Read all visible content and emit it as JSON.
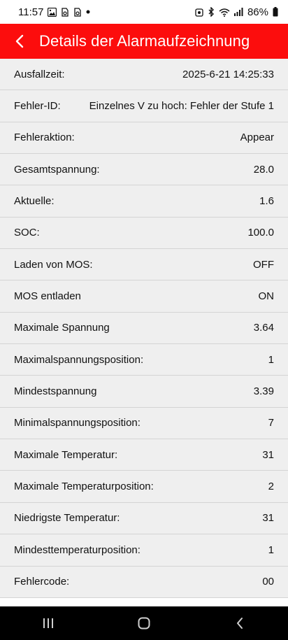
{
  "status_bar": {
    "time": "11:57",
    "battery": "86%",
    "icons": [
      "gallery-icon",
      "notification-icon",
      "notification-icon",
      "dot-icon",
      "alarm-icon",
      "bluetooth-icon",
      "wifi-icon",
      "signal-icon",
      "battery-icon"
    ]
  },
  "app_bar": {
    "title": "Details der Alarmaufzeichnung",
    "back_icon": "chevron-left-icon",
    "color": "#fc0d0d"
  },
  "rows": [
    {
      "label": "Ausfallzeit:",
      "value": "2025-6-21 14:25:33"
    },
    {
      "label": "Fehler-ID:",
      "value": "Einzelnes V zu hoch: Fehler der Stufe 1"
    },
    {
      "label": "Fehleraktion:",
      "value": "Appear"
    },
    {
      "label": "Gesamtspannung:",
      "value": "28.0"
    },
    {
      "label": "Aktuelle:",
      "value": "1.6"
    },
    {
      "label": "SOC:",
      "value": "100.0"
    },
    {
      "label": "Laden von MOS:",
      "value": "OFF"
    },
    {
      "label": "MOS entladen",
      "value": "ON"
    },
    {
      "label": "Maximale Spannung",
      "value": "3.64"
    },
    {
      "label": "Maximalspannungsposition:",
      "value": "1"
    },
    {
      "label": "Mindestspannung",
      "value": "3.39"
    },
    {
      "label": "Minimalspannungsposition:",
      "value": "7"
    },
    {
      "label": "Maximale Temperatur:",
      "value": "31"
    },
    {
      "label": "Maximale Temperaturposition:",
      "value": "2"
    },
    {
      "label": "Niedrigste Temperatur:",
      "value": "31"
    },
    {
      "label": "Mindesttemperaturposition:",
      "value": "1"
    },
    {
      "label": "Fehlercode:",
      "value": "00"
    }
  ],
  "nav_bar": {
    "buttons": [
      "recent-apps-icon",
      "home-icon",
      "back-icon"
    ]
  }
}
